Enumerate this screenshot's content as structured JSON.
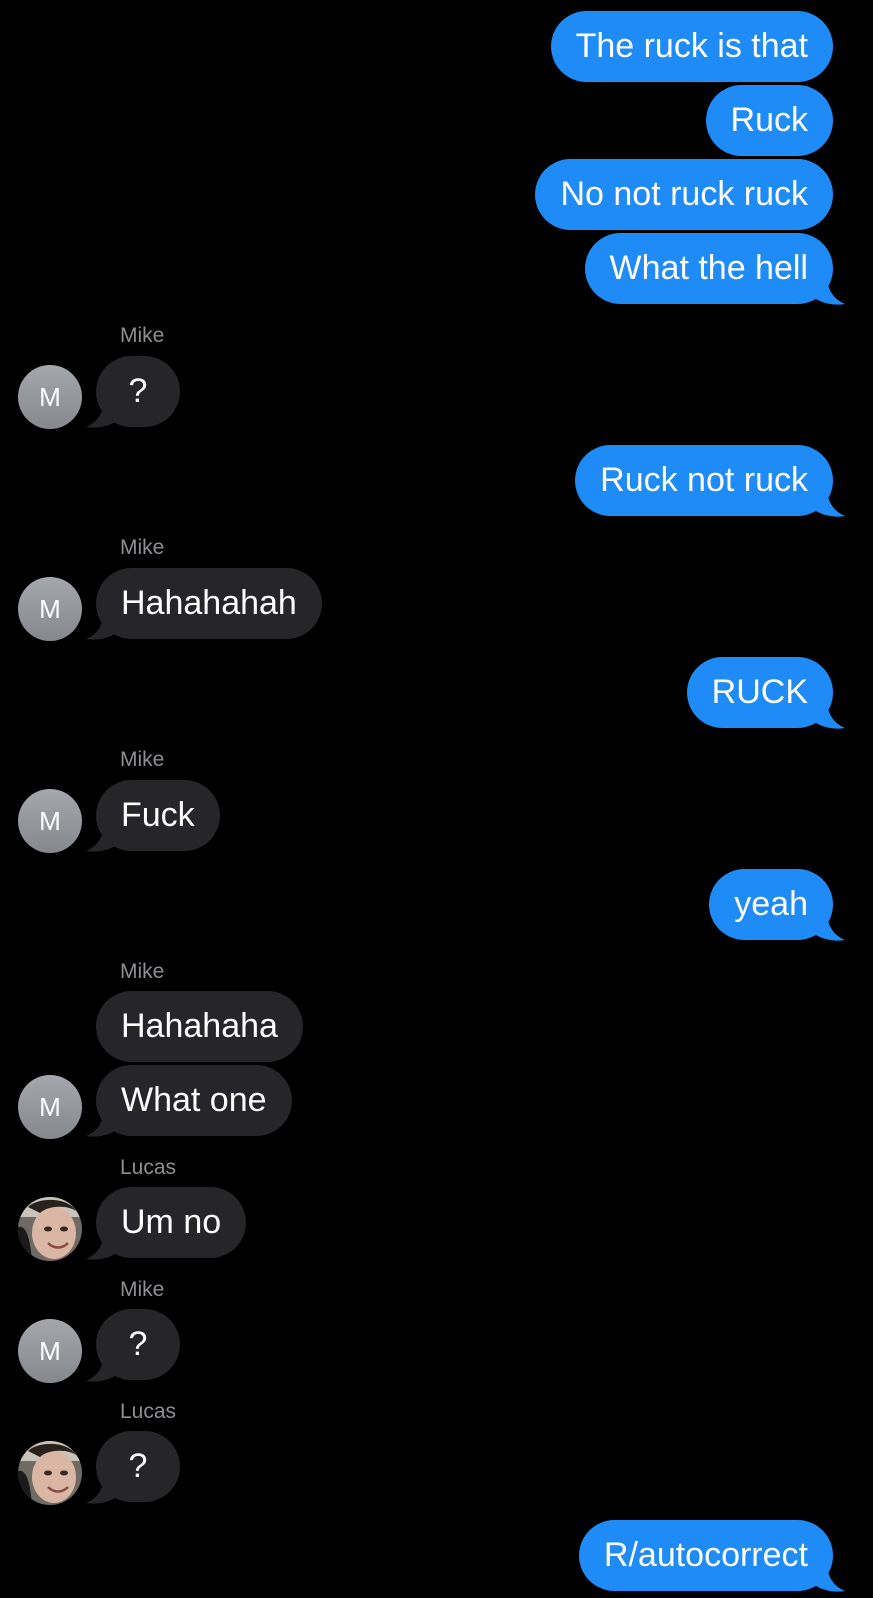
{
  "colors": {
    "outgoing_bubble": "#1f8bf7",
    "incoming_bubble": "#262629",
    "sender_label": "#8e8e93",
    "background": "#000000"
  },
  "messages": [
    {
      "dir": "out",
      "text": "The ruck is that"
    },
    {
      "dir": "out",
      "text": "Ruck"
    },
    {
      "dir": "out",
      "text": "No not ruck ruck"
    },
    {
      "dir": "out",
      "text": "What the hell"
    },
    {
      "dir": "in",
      "sender": "Mike",
      "avatar": "M",
      "text": "?"
    },
    {
      "dir": "out",
      "text": "Ruck not ruck"
    },
    {
      "dir": "in",
      "sender": "Mike",
      "avatar": "M",
      "text": "Hahahahah"
    },
    {
      "dir": "out",
      "text": "RUCK"
    },
    {
      "dir": "in",
      "sender": "Mike",
      "avatar": "M",
      "text": "Fuck"
    },
    {
      "dir": "out",
      "text": "yeah"
    },
    {
      "dir": "in",
      "sender": "Mike",
      "text": "Hahahaha"
    },
    {
      "dir": "in",
      "avatar": "M",
      "text": "What one"
    },
    {
      "dir": "in",
      "sender": "Lucas",
      "avatar_icon": "person-photo-icon",
      "text": "Um no"
    },
    {
      "dir": "in",
      "sender": "Mike",
      "avatar": "M",
      "text": "?"
    },
    {
      "dir": "in",
      "sender": "Lucas",
      "avatar_icon": "person-photo-icon",
      "text": "?"
    },
    {
      "dir": "out",
      "text": "R/autocorrect"
    }
  ]
}
